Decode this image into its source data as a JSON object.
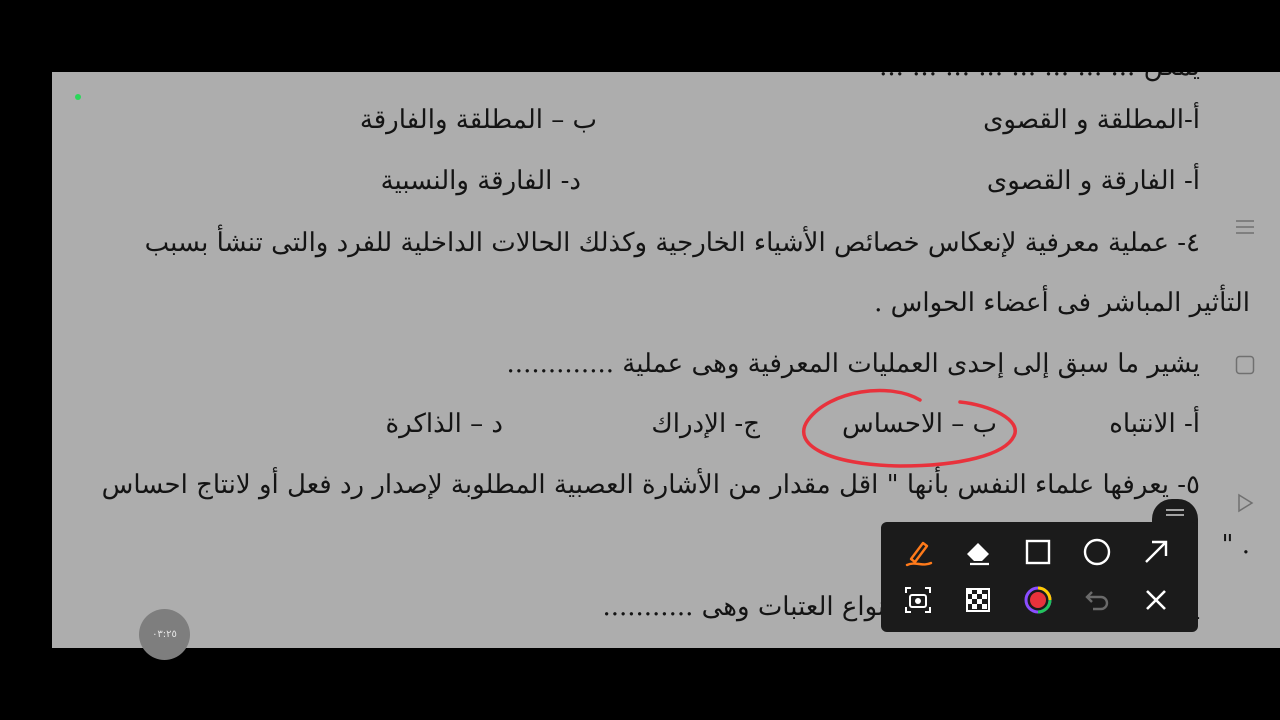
{
  "document": {
    "line_top_partial": "يمكن ... ... ... ... ... ... ... ...",
    "opt_a1": "أ-المطلقة و القصوى",
    "opt_b1": "ب – المطلقة والفارقة",
    "opt_a2": "أ-  الفارقة و القصوى",
    "opt_d2": "د- الفارقة والنسبية",
    "q4_line1": "٤- عملية معرفية لإنعكاس خصائص الأشياء الخارجية وكذلك الحالات الداخلية للفرد والتى تنشأ بسبب",
    "q4_line2": "التأثير المباشر فى أعضاء الحواس .",
    "q4_prompt": "يشير ما سبق إلى إحدى العمليات المعرفية وهى عملية .............",
    "q4_opt_a": "أ- الانتباه",
    "q4_opt_b": "ب – الاحساس",
    "q4_opt_c": "ج- الإدراك",
    "q4_opt_d": "د – الذاكرة",
    "q5_line1": "٥- يعرفها علماء النفس بأنها \" اقل مقدار من الأشارة العصبية المطلوبة لإصدار رد فعل أو لانتاج احساس",
    "q5_line2": ". \"",
    "q5_prompt": "يفسر التعريف السابق إحدى أنواع العتبات وهى ..........."
  },
  "annotation": {
    "circle_color": "#e8323c"
  },
  "timer": {
    "text": "٠٣:٢٥"
  },
  "side_icons": [
    "menu-icon",
    "checkbox-icon",
    "play-icon"
  ],
  "toolbar": {
    "accent": "#ff7a1a",
    "tools": [
      "pen-icon",
      "eraser-icon",
      "rectangle-icon",
      "circle-icon",
      "arrow-icon",
      "camera-icon",
      "mosaic-icon",
      "color-picker-icon",
      "undo-icon",
      "close-icon"
    ]
  }
}
